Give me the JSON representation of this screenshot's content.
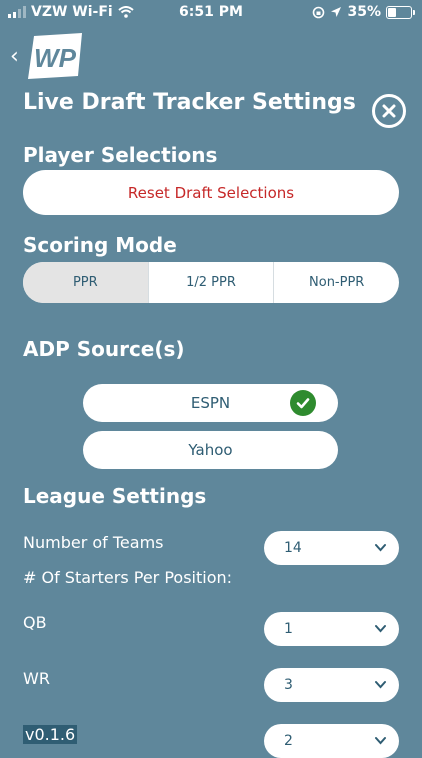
{
  "status_bar": {
    "carrier": "VZW Wi-Fi",
    "time": "6:51 PM",
    "battery": "35%",
    "battery_level": 0.35,
    "icons": [
      "signal-icon",
      "wifi-icon",
      "orientation-lock-icon",
      "location-icon",
      "battery-icon"
    ]
  },
  "header": {
    "title": "Live Draft Tracker Settings",
    "logo_text": "WP",
    "back_icon": "chevron-left-icon",
    "close_icon": "close-icon"
  },
  "player_selections": {
    "heading": "Player Selections",
    "reset_label": "Reset Draft Selections"
  },
  "scoring_mode": {
    "heading": "Scoring Mode",
    "options": [
      "PPR",
      "1/2 PPR",
      "Non-PPR"
    ],
    "selected": "PPR"
  },
  "adp": {
    "heading": "ADP Source(s)",
    "sources": [
      {
        "label": "ESPN",
        "checked": true
      },
      {
        "label": "Yahoo",
        "checked": false
      }
    ]
  },
  "league": {
    "heading": "League Settings",
    "num_teams_label": "Number of Teams",
    "num_teams_value": "14",
    "starters_label": "# Of Starters Per Position:",
    "positions": [
      {
        "label": "QB",
        "value": "1"
      },
      {
        "label": "WR",
        "value": "3"
      },
      {
        "label": "",
        "value": "2"
      }
    ]
  },
  "version": "v0.1.6",
  "colors": {
    "background": "#5f879b",
    "reset_text": "#c62828",
    "control_text": "#2f5d73",
    "check": "#2e8b2e",
    "selected_segment": "#e4e4e4"
  }
}
